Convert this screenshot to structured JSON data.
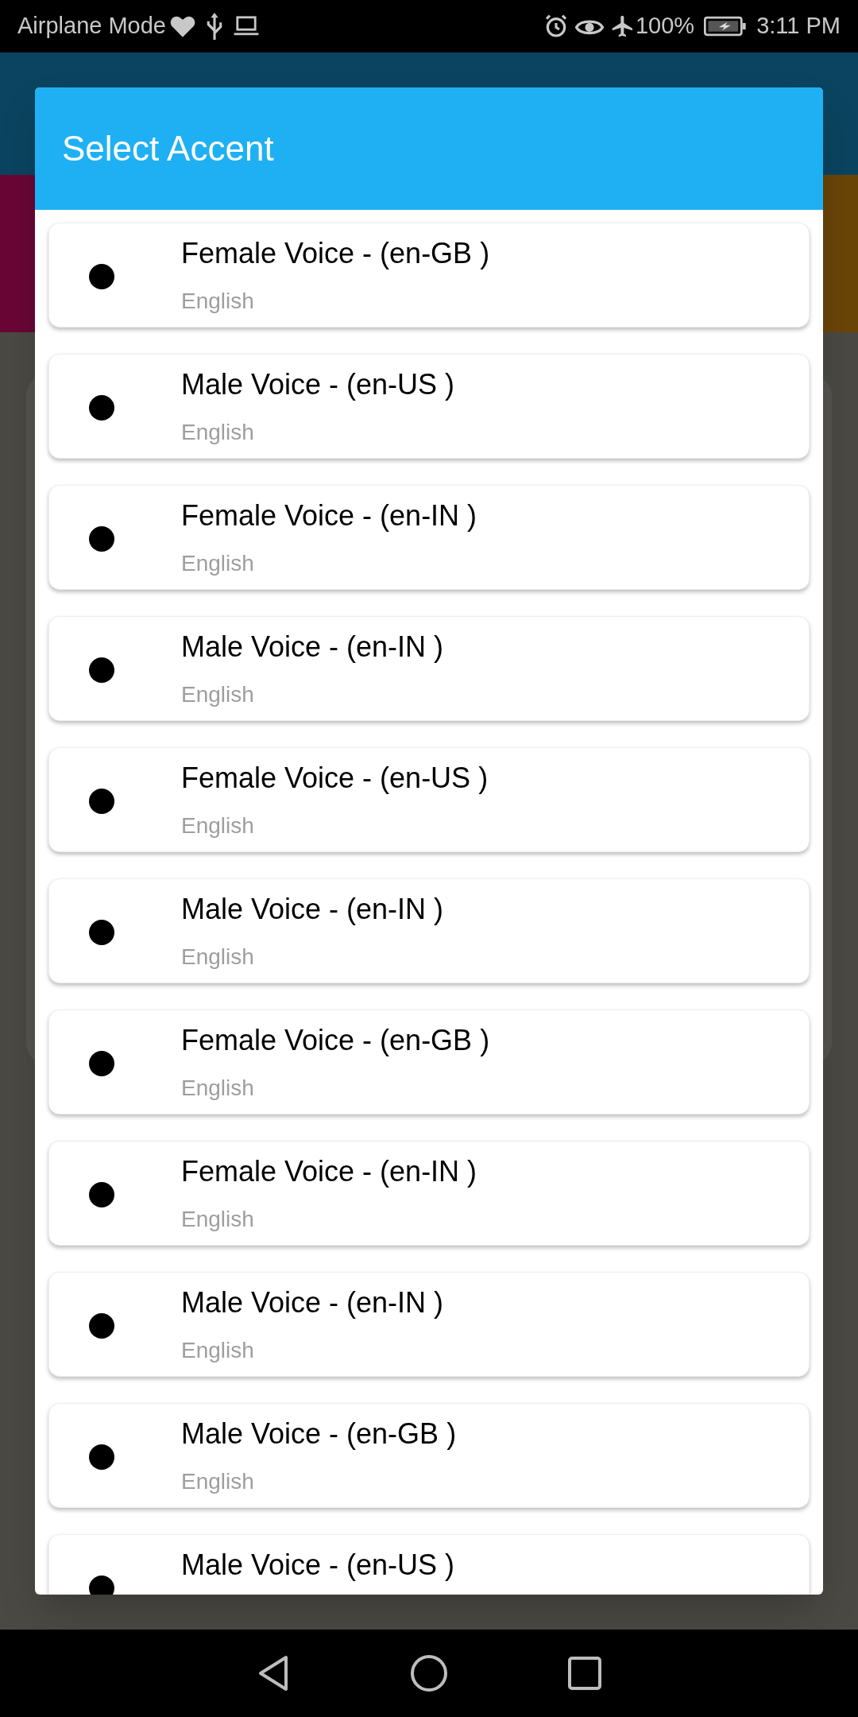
{
  "status_bar": {
    "left_text": "Airplane Mode",
    "battery": "100%",
    "time": "3:11 PM"
  },
  "dialog": {
    "title": "Select Accent",
    "items": [
      {
        "title": "Female Voice - (en-GB )",
        "subtitle": "English"
      },
      {
        "title": "Male Voice - (en-US )",
        "subtitle": "English"
      },
      {
        "title": "Female Voice - (en-IN )",
        "subtitle": "English"
      },
      {
        "title": "Male Voice - (en-IN )",
        "subtitle": "English"
      },
      {
        "title": "Female Voice - (en-US )",
        "subtitle": "English"
      },
      {
        "title": "Male Voice - (en-IN )",
        "subtitle": "English"
      },
      {
        "title": "Female Voice - (en-GB )",
        "subtitle": "English"
      },
      {
        "title": "Female Voice - (en-IN )",
        "subtitle": "English"
      },
      {
        "title": "Male Voice - (en-IN )",
        "subtitle": "English"
      },
      {
        "title": "Male Voice - (en-GB )",
        "subtitle": "English"
      },
      {
        "title": "Male Voice - (en-US )"
      }
    ]
  }
}
